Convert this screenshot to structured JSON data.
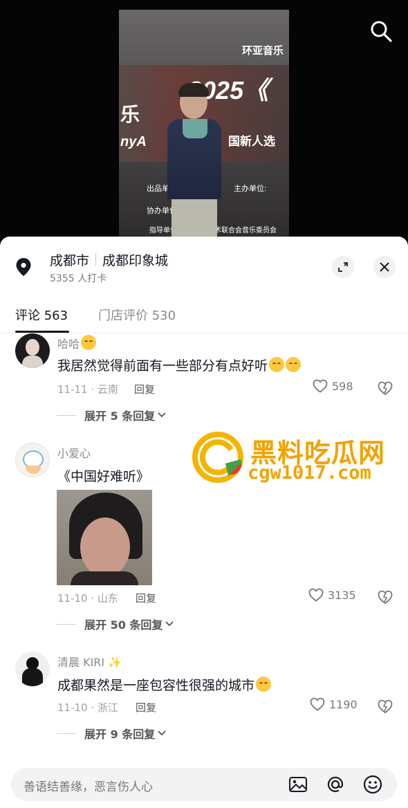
{
  "video": {
    "banner_line1": "环亚音乐",
    "banner_line2": "2025《",
    "banner_line3": "国新人选",
    "banner_left": "乐",
    "banner_left_sub": "nyA",
    "banner_credit1": "出品单",
    "banner_credit2": "主办单位:",
    "banner_credit3": "协办单位",
    "banner_credit4": "指导单位",
    "banner_credit5": "视艺术联合会音乐委员会"
  },
  "location": {
    "city": "成都市",
    "place": "成都印象城",
    "checkins": "5355 人打卡"
  },
  "tabs": [
    {
      "label": "评论 563",
      "active": true
    },
    {
      "label": "门店评价 530",
      "active": false
    }
  ],
  "comments": [
    {
      "name": "哈哈",
      "text": "我居然觉得前面有一些部分有点好听",
      "date_region": "11-11 · 云南",
      "reply": "回复",
      "likes": "598",
      "expand": "展开 5 条回复"
    },
    {
      "name": "小爱心",
      "text": "《中国好难听》",
      "date_region": "11-10 · 山东",
      "reply": "回复",
      "likes": "3135",
      "expand": "展开 50 条回复"
    },
    {
      "name": "清晨 KIRI ✨",
      "text": "成都果然是一座包容性很强的城市",
      "date_region": "11-10 · 浙江",
      "reply": "回复",
      "likes": "1190",
      "expand": "展开 9 条回复"
    }
  ],
  "watermark": {
    "title": "黑料吃瓜网",
    "url": "cgw1017.com"
  },
  "input": {
    "placeholder": "善语结善缘，恶言伤人心"
  },
  "icons": [
    "search-icon",
    "location-pin-icon",
    "expand-icon",
    "close-icon",
    "heart-icon",
    "dislike-icon",
    "chevron-down-icon",
    "image-icon",
    "at-icon",
    "emoji-icon"
  ]
}
